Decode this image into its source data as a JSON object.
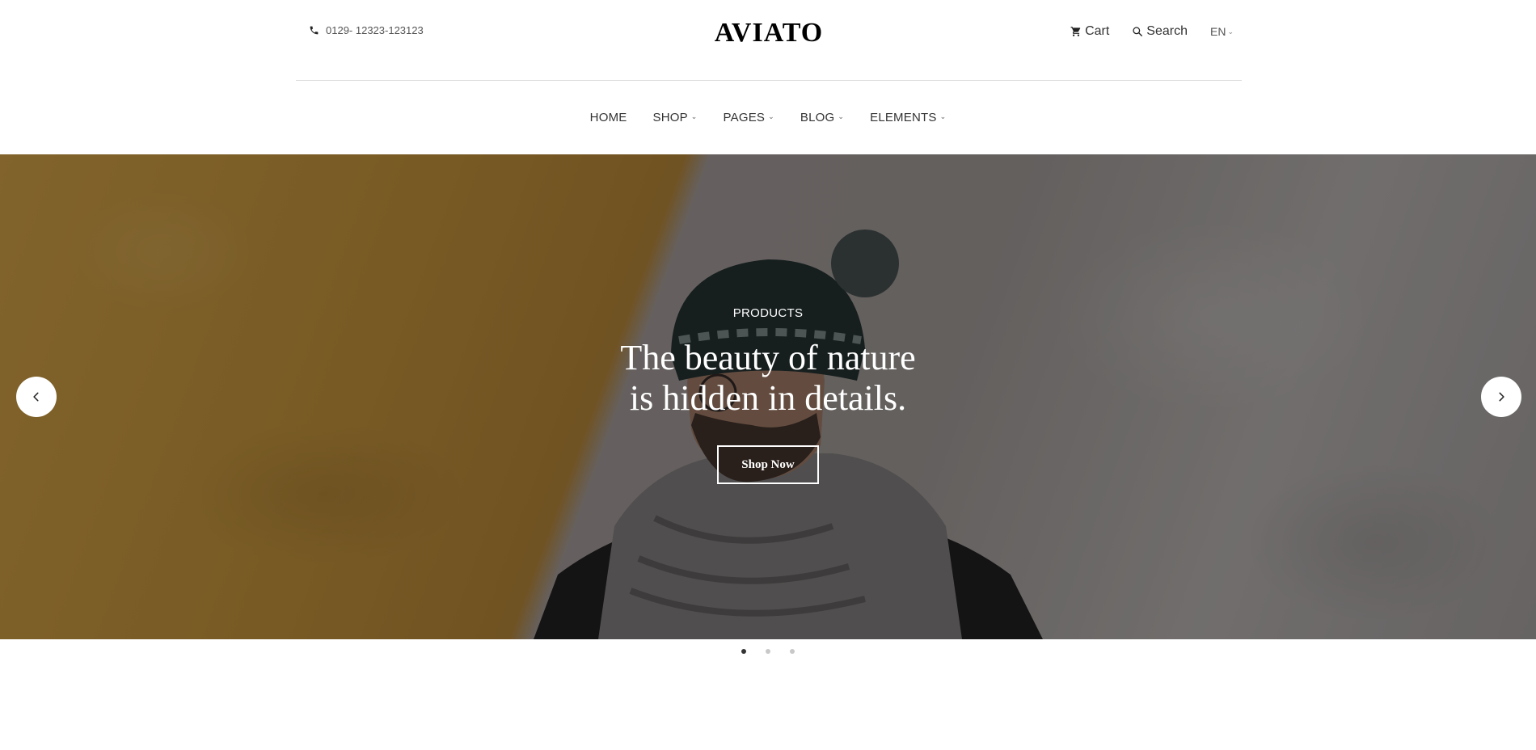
{
  "header": {
    "phone": "0129- 12323-123123",
    "logo": "AVIATO",
    "cart_label": "Cart",
    "search_label": "Search",
    "language": "EN"
  },
  "nav": {
    "items": [
      {
        "label": "HOME",
        "has_dropdown": false
      },
      {
        "label": "SHOP",
        "has_dropdown": true
      },
      {
        "label": "PAGES",
        "has_dropdown": true
      },
      {
        "label": "BLOG",
        "has_dropdown": true
      },
      {
        "label": "ELEMENTS",
        "has_dropdown": true
      }
    ]
  },
  "hero": {
    "kicker": "PRODUCTS",
    "title_line1": "The beauty of nature",
    "title_line2": "is hidden in details.",
    "button_label": "Shop Now",
    "slide_count": 3,
    "active_slide": 1
  },
  "colors": {
    "wall_left": "#a77e33",
    "wall_right": "#8a8583",
    "text_dark": "#333333"
  }
}
